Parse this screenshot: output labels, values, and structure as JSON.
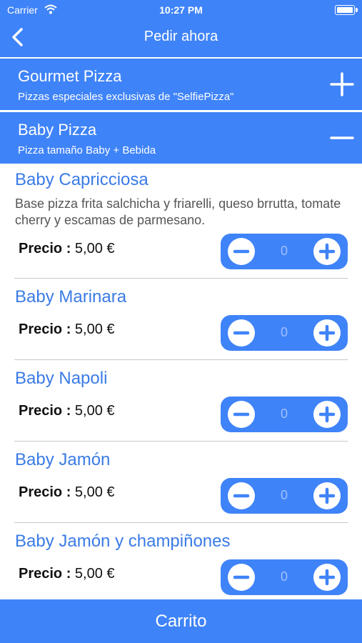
{
  "status": {
    "carrier": "Carrier",
    "time": "10:27 PM"
  },
  "nav": {
    "title": "Pedir ahora"
  },
  "sections": [
    {
      "title": "Gourmet Pizza",
      "subtitle": "Pizzas especiales exclusivas de \"SelfiePizza\""
    },
    {
      "title": "Baby Pizza",
      "subtitle": "Pizza tamaño Baby + Bebida"
    }
  ],
  "price_label": "Precio :",
  "items": [
    {
      "name": "Baby Capricciosa",
      "description": "Base pizza frita salchicha y friarelli, queso brrutta, tomate cherry y escamas de parmesano.",
      "price": "5,00 €",
      "qty": "0"
    },
    {
      "name": "Baby Marinara",
      "price": "5,00 €",
      "qty": "0"
    },
    {
      "name": "Baby Napoli",
      "price": "5,00 €",
      "qty": "0"
    },
    {
      "name": "Baby Jamón",
      "price": "5,00 €",
      "qty": "0"
    },
    {
      "name": "Baby Jamón y champiñones",
      "price": "5,00 €",
      "qty": "0"
    }
  ],
  "cart": {
    "label": "Carrito"
  },
  "colors": {
    "accent": "#3f83f8",
    "item_title": "#3a7be6"
  }
}
